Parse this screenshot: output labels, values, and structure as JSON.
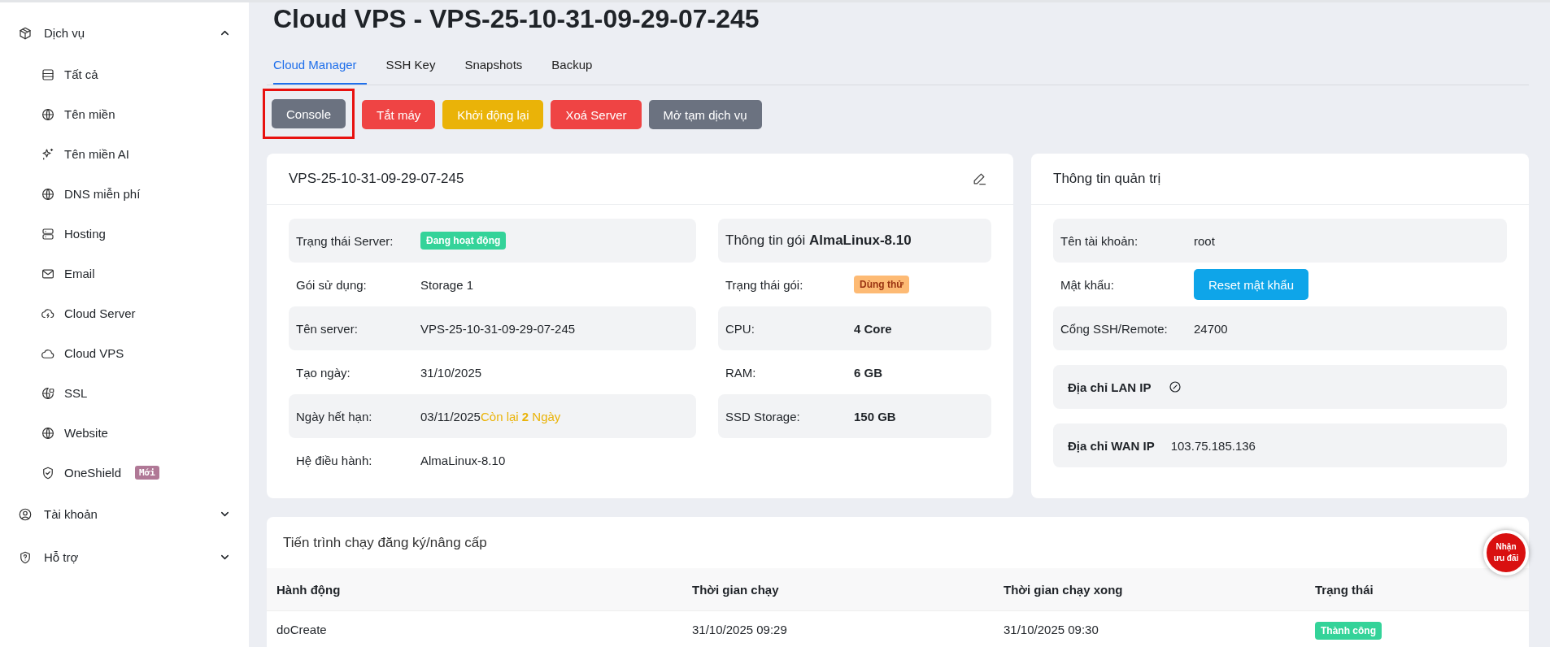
{
  "sidebar": {
    "groups": [
      {
        "label": "Dịch vụ",
        "expanded": true,
        "children": [
          {
            "label": "Tất cả"
          },
          {
            "label": "Tên miền"
          },
          {
            "label": "Tên miền AI"
          },
          {
            "label": "DNS miễn phí"
          },
          {
            "label": "Hosting"
          },
          {
            "label": "Email"
          },
          {
            "label": "Cloud Server"
          },
          {
            "label": "Cloud VPS"
          },
          {
            "label": "SSL"
          },
          {
            "label": "Website"
          },
          {
            "label": "OneShield",
            "badge": "Mới"
          }
        ]
      },
      {
        "label": "Tài khoản",
        "expanded": false
      },
      {
        "label": "Hỗ trợ",
        "expanded": false
      }
    ]
  },
  "page_title": "Cloud VPS - VPS-25-10-31-09-29-07-245",
  "tabs": [
    {
      "label": "Cloud Manager",
      "selected": true
    },
    {
      "label": "SSH Key",
      "selected": false
    },
    {
      "label": "Snapshots",
      "selected": false
    },
    {
      "label": "Backup",
      "selected": false
    }
  ],
  "actions": [
    {
      "label": "Console",
      "kind": "secondary",
      "highlighted": true
    },
    {
      "label": "Tắt máy",
      "kind": "danger",
      "highlighted": false
    },
    {
      "label": "Khởi động lại",
      "kind": "warning",
      "highlighted": false
    },
    {
      "label": "Xoá Server",
      "kind": "danger",
      "highlighted": false
    },
    {
      "label": "Mở tạm dịch vụ",
      "kind": "secondary",
      "highlighted": false
    }
  ],
  "server_card": {
    "title": "VPS-25-10-31-09-29-07-245",
    "details": [
      {
        "label": "Trạng thái Server:",
        "badge": {
          "text": "Đang hoạt động",
          "kind": "success"
        }
      },
      {
        "label": "Gói sử dụng:",
        "value": "Storage 1"
      },
      {
        "label": "Tên server:",
        "value": "VPS-25-10-31-09-29-07-245"
      },
      {
        "label": "Tạo ngày:",
        "value": "31/10/2025"
      },
      {
        "label": "Ngày hết hạn:",
        "value": "03/11/2025",
        "note": "Còn lại **2** Ngày"
      },
      {
        "label": "Hệ điều hành:",
        "value": "AlmaLinux-8.10"
      }
    ],
    "package": {
      "title": "Thông tin gói **AlmaLinux-8.10**",
      "rows": [
        {
          "label": "Trạng thái gói:",
          "badge": {
            "text": "Dùng thử",
            "kind": "warning"
          }
        },
        {
          "label": "CPU:",
          "value": "4 Core"
        },
        {
          "label": "RAM:",
          "value": "6 GB"
        },
        {
          "label": "SSD Storage:",
          "value": "150 GB"
        }
      ]
    }
  },
  "admin_card": {
    "title": "Thông tin quản trị",
    "rows": [
      {
        "kind": "text",
        "label": "Tên tài khoản:",
        "value": "root"
      },
      {
        "kind": "button",
        "label": "Mật khẩu:",
        "button": "Reset mật khẩu"
      },
      {
        "kind": "text",
        "label": "Cổng SSH/Remote:",
        "value": "24700"
      }
    ],
    "addresses": [
      {
        "kind": "empty",
        "label": "Địa chỉ LAN IP"
      },
      {
        "kind": "value",
        "label": "Địa chỉ WAN IP",
        "value": "103.75.185.136"
      }
    ]
  },
  "progress": {
    "title": "Tiến trình chạy đăng ký/nâng cấp",
    "columns": [
      "Hành động",
      "Thời gian chạy",
      "Thời gian chạy xong",
      "Trạng thái"
    ],
    "rows": [
      {
        "action": "doCreate",
        "start": "31/10/2025 09:29",
        "end": "31/10/2025 09:30",
        "status": {
          "text": "Thành công",
          "kind": "success"
        }
      }
    ]
  },
  "promo_button": {
    "text": "Nhận ưu đãi"
  }
}
